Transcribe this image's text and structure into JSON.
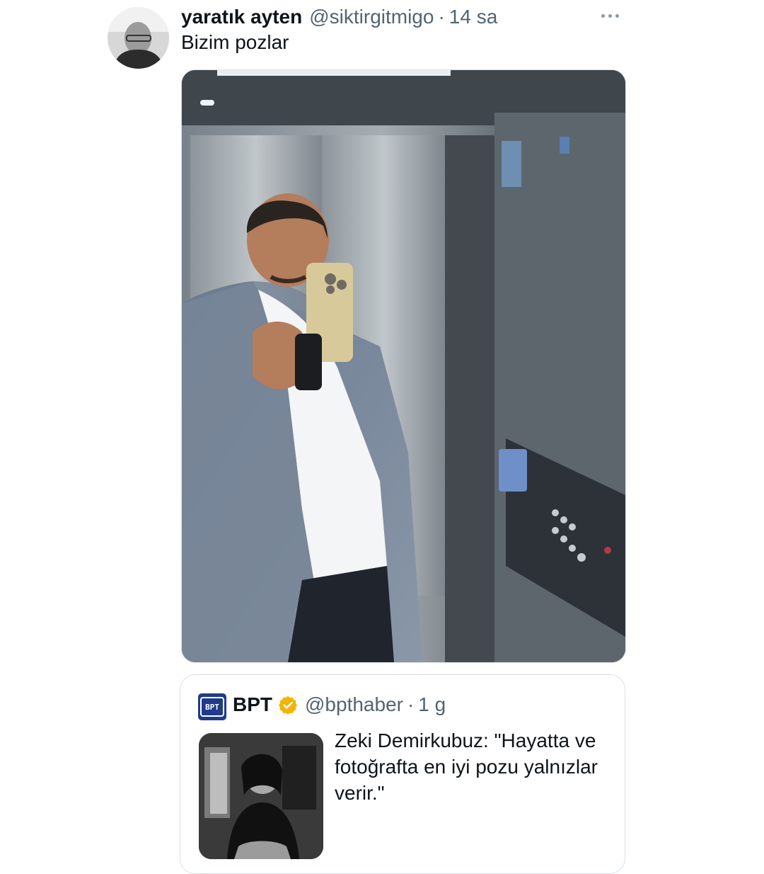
{
  "tweet": {
    "display_name": "yaratık ayten",
    "handle": "@siktirgitmigo",
    "separator": "·",
    "time": "14 sa",
    "text": "Bizim pozlar"
  },
  "quote": {
    "name": "BPT",
    "handle": "@bpthaber",
    "separator": "·",
    "time": "1 g",
    "text": "Zeki Demirkubuz: \"Hayatta ve fotoğrafta en iyi pozu yalnızlar verir.\"",
    "logo_text": "BPT"
  },
  "colors": {
    "verified": "#f4b400",
    "secondary": "#536471",
    "quote_logo": "#1f3b8a"
  }
}
